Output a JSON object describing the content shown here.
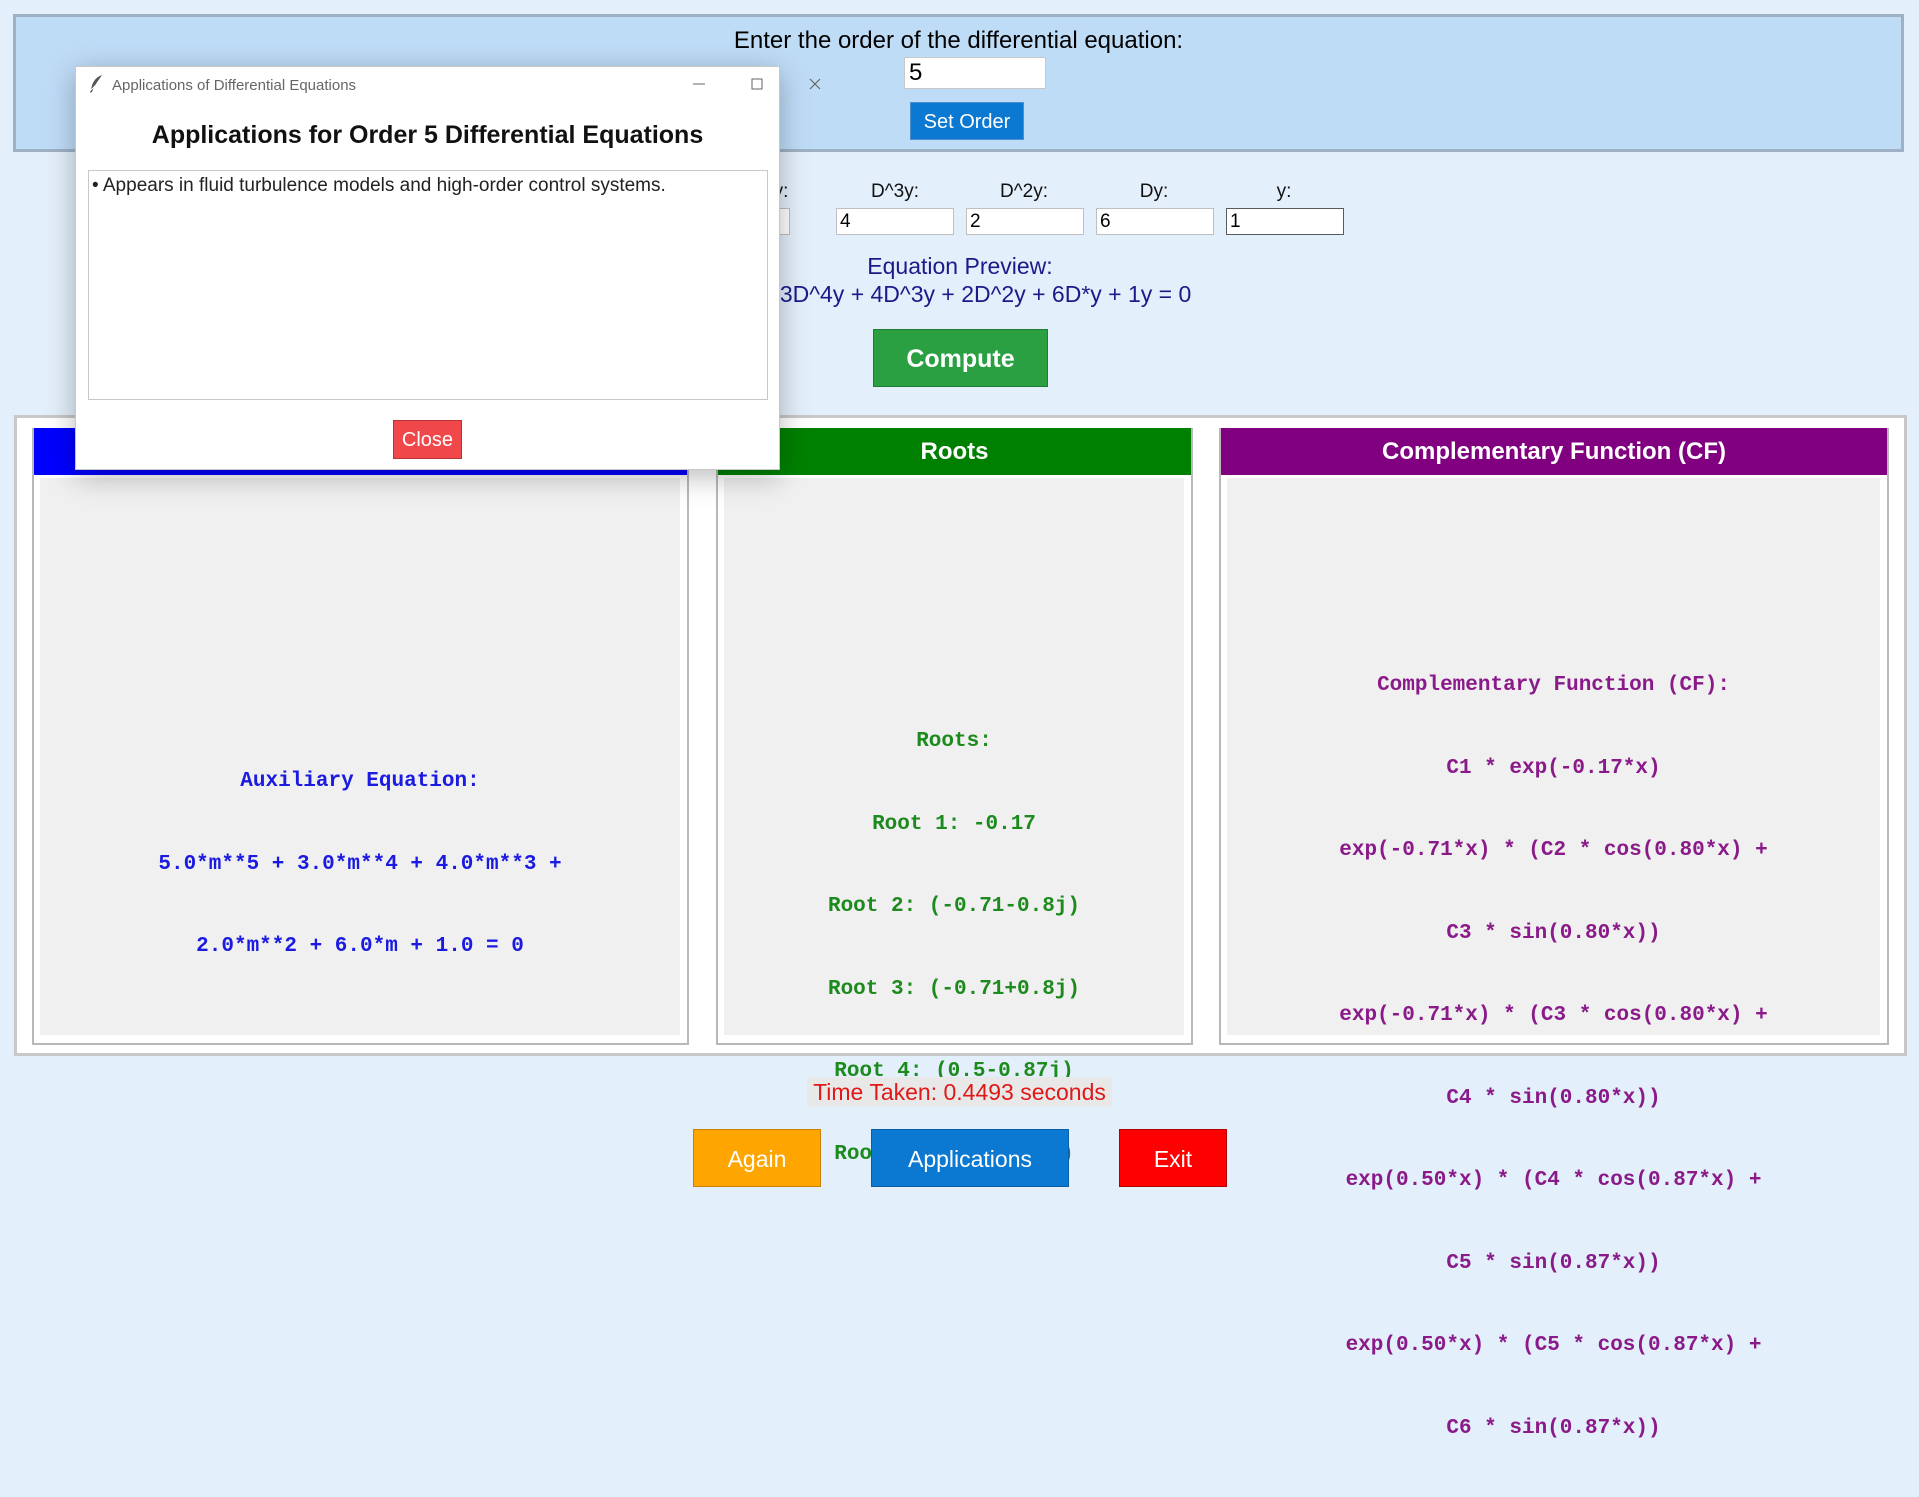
{
  "order_panel": {
    "prompt": "Enter the order of the differential equation:",
    "order_value": "5",
    "set_order_label": "Set Order"
  },
  "coefficients": [
    {
      "label": "y:",
      "value": ""
    },
    {
      "label": "D^3y:",
      "value": "4"
    },
    {
      "label": "D^2y:",
      "value": "2"
    },
    {
      "label": "Dy:",
      "value": "6"
    },
    {
      "label": "y:",
      "value": "1"
    }
  ],
  "preview": {
    "title": "Equation Preview:",
    "equation": "+ 3D^4y + 4D^3y + 2D^2y + 6D*y + 1y = 0"
  },
  "compute_label": "Compute",
  "panes": {
    "auxiliary": {
      "color": "#0000ff",
      "lines": [
        "Auxiliary Equation:",
        "5.0*m**5 + 3.0*m**4 + 4.0*m**3 +",
        "2.0*m**2 + 6.0*m + 1.0 = 0"
      ]
    },
    "roots": {
      "title": "Roots",
      "color": "#008000",
      "lines": [
        "Roots:",
        "Root 1: -0.17",
        "Root 2: (-0.71-0.8j)",
        "Root 3: (-0.71+0.8j)",
        "Root 4: (0.5-0.87j)",
        "Root 5: (0.5+0.87j)"
      ]
    },
    "cf": {
      "title": "Complementary Function (CF)",
      "color": "#800080",
      "lines": [
        "Complementary Function (CF):",
        "C1 * exp(-0.17*x)",
        "exp(-0.71*x) * (C2 * cos(0.80*x) +",
        "C3 * sin(0.80*x))",
        "exp(-0.71*x) * (C3 * cos(0.80*x) +",
        "C4 * sin(0.80*x))",
        "exp(0.50*x) * (C4 * cos(0.87*x) +",
        "C5 * sin(0.87*x))",
        "exp(0.50*x) * (C5 * cos(0.87*x) +",
        "C6 * sin(0.87*x))"
      ]
    }
  },
  "time_taken": "Time Taken: 0.4493 seconds",
  "buttons": {
    "again": "Again",
    "applications": "Applications",
    "exit": "Exit"
  },
  "popup": {
    "window_title": "Applications of Differential Equations",
    "heading": "Applications for Order 5 Differential Equations",
    "text": "• Appears in fluid turbulence models and high-order control systems.",
    "close_label": "Close"
  },
  "colors": {
    "background": "#e3effa",
    "set_order": "#0b78d1",
    "compute": "#2aa043",
    "again": "#ffa500",
    "applications": "#0b78d1",
    "exit": "#ff0000",
    "close": "#f0474a",
    "time_taken": "#e01818"
  }
}
